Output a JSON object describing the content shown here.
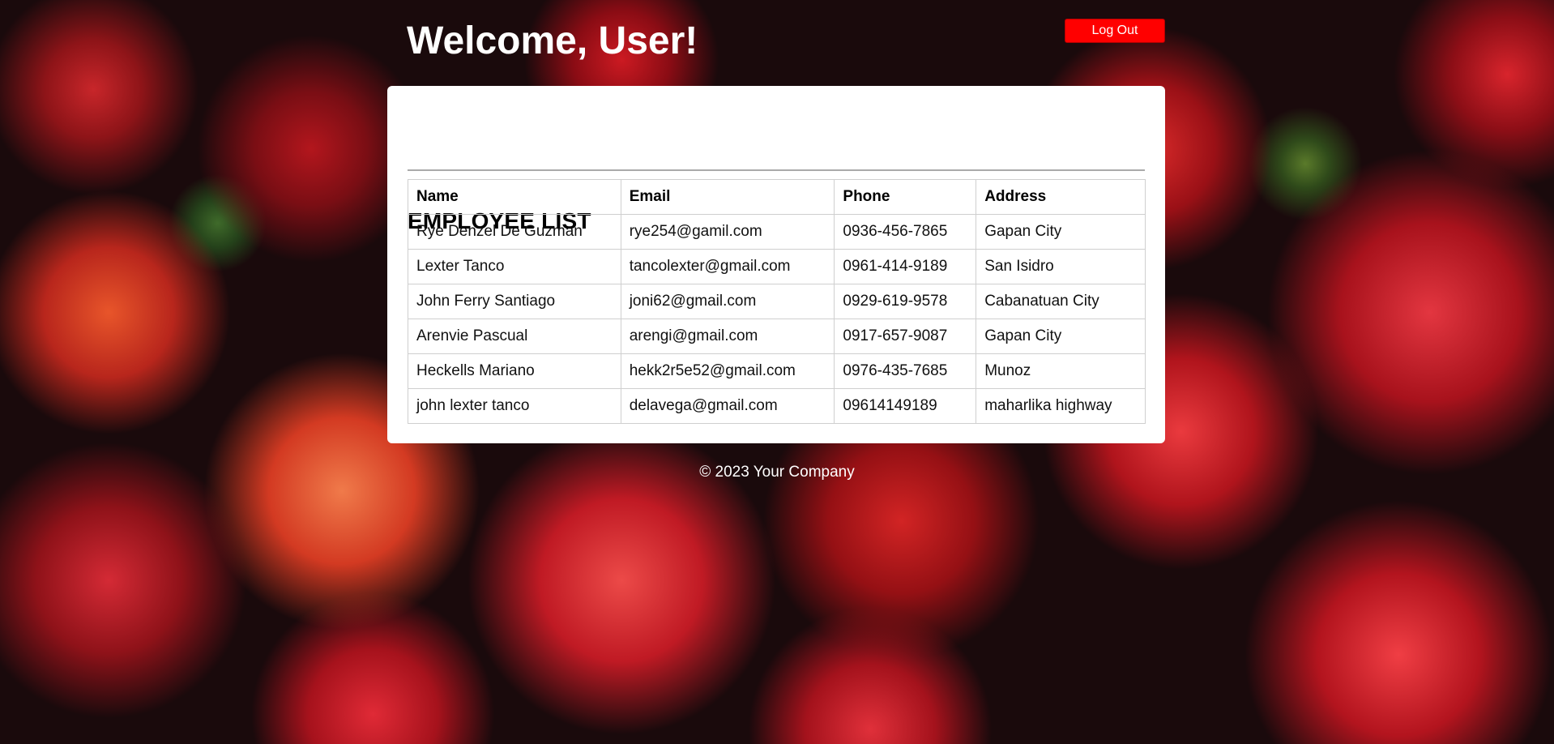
{
  "header": {
    "title": "Welcome, User!",
    "logout_label": "Log Out"
  },
  "employee_list": {
    "title": "EMPLOYEE LIST",
    "columns": [
      "Name",
      "Email",
      "Phone",
      "Address"
    ],
    "rows": [
      [
        "Rye Denzel De Guzman",
        "rye254@gamil.com",
        "0936-456-7865",
        "Gapan City"
      ],
      [
        "Lexter Tanco",
        "tancolexter@gmail.com",
        "0961-414-9189",
        "San Isidro"
      ],
      [
        "John Ferry Santiago",
        "joni62@gmail.com",
        "0929-619-9578",
        "Cabanatuan City"
      ],
      [
        "Arenvie Pascual",
        "arengi@gmail.com",
        "0917-657-9087",
        "Gapan City"
      ],
      [
        "Heckells Mariano",
        "hekk2r5e52@gmail.com",
        "0976-435-7685",
        "Munoz"
      ],
      [
        "john lexter tanco",
        "delavega@gmail.com",
        "09614149189",
        "maharlika highway"
      ]
    ]
  },
  "footer": {
    "text": "© 2023 Your Company"
  },
  "colors": {
    "logout_button": "#ff0000",
    "card_background": "#ffffff"
  }
}
